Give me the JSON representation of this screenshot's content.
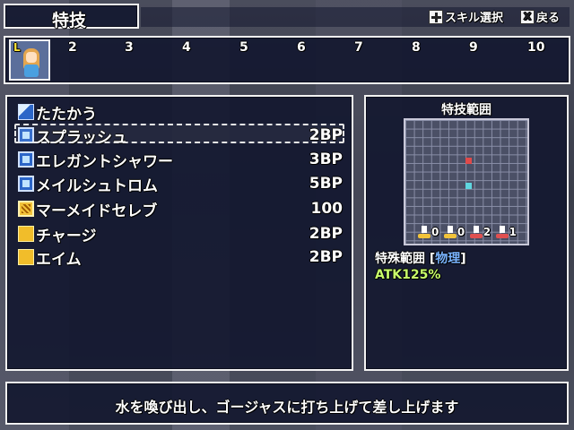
{
  "header": {
    "title": "特技"
  },
  "hints": [
    {
      "icon": "dpad-icon",
      "label": "スキル選択"
    },
    {
      "icon": "x-button-icon",
      "key": "X",
      "label": "戻る"
    }
  ],
  "party": {
    "leader_badge": "L",
    "numbers": [
      "2",
      "3",
      "4",
      "5",
      "6",
      "7",
      "8",
      "9",
      "10"
    ]
  },
  "skills": [
    {
      "name": "たたかう",
      "cost": "",
      "icon": "sword-icon"
    },
    {
      "name": "スプラッシュ",
      "cost": "2BP",
      "icon": "water-magic-icon",
      "selected": true
    },
    {
      "name": "エレガントシャワー",
      "cost": "3BP",
      "icon": "water-magic-icon"
    },
    {
      "name": "メイルシュトロム",
      "cost": "5BP",
      "icon": "water-magic-icon"
    },
    {
      "name": "マーメイドセレブ",
      "cost": "100",
      "icon": "special-skill-icon"
    },
    {
      "name": "チャージ",
      "cost": "2BP",
      "icon": "buff-icon"
    },
    {
      "name": "エイム",
      "cost": "2BP",
      "icon": "buff-icon"
    }
  ],
  "range_panel": {
    "title": "特技範囲",
    "stats": [
      {
        "value": "0",
        "color": "#f2c33a"
      },
      {
        "value": "0",
        "color": "#f2c33a"
      },
      {
        "value": "2",
        "color": "#e05050"
      },
      {
        "value": "1",
        "color": "#e05050"
      }
    ],
    "special_label": "特殊範囲",
    "bracket_open": "[",
    "attack_kind": "物理",
    "bracket_close": "]",
    "atk": "ATK125%"
  },
  "description": "水を喚び出し、ゴージャスに打ち上げて差し上げます"
}
